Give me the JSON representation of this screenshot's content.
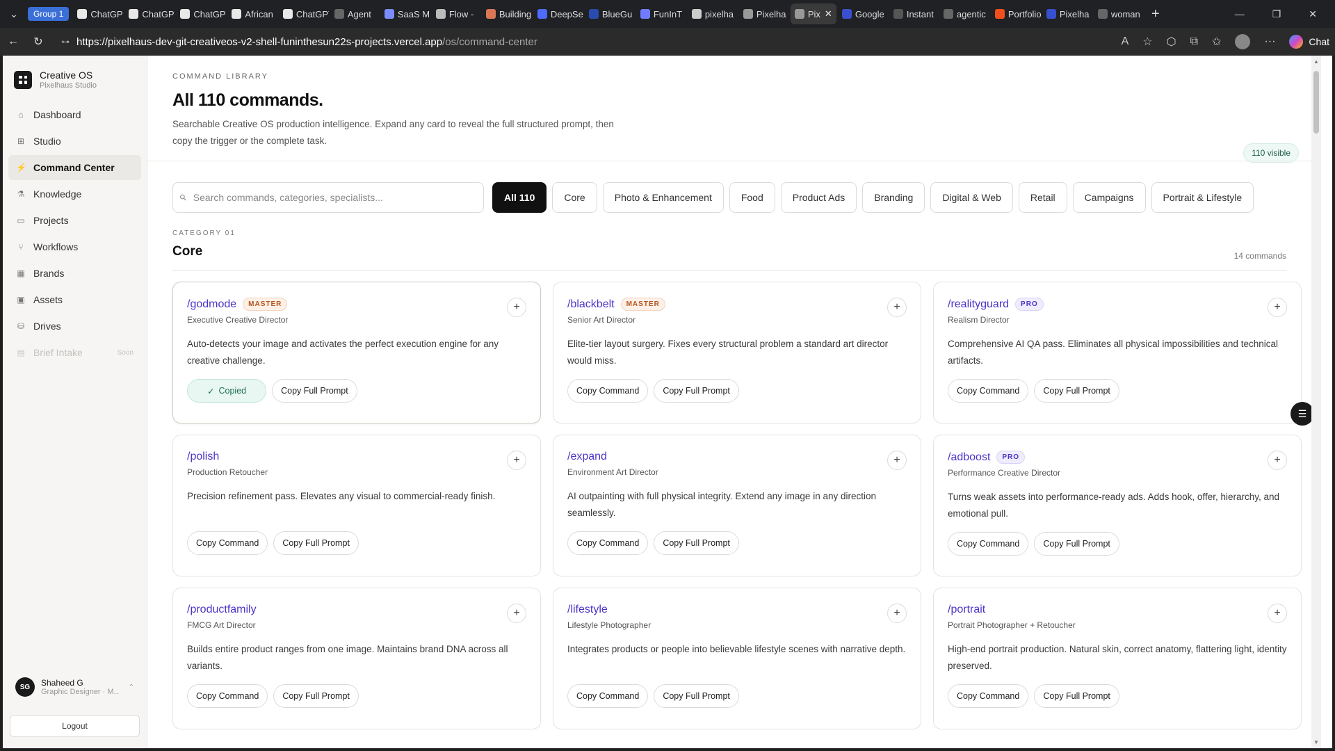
{
  "browser": {
    "group_label": "Group 1",
    "tabs": [
      {
        "title": "ChatGPT",
        "icon": "chatgpt-icon"
      },
      {
        "title": "ChatGPT",
        "icon": "chatgpt-icon"
      },
      {
        "title": "ChatGPT",
        "icon": "chatgpt-icon"
      },
      {
        "title": "African",
        "icon": "chatgpt-icon"
      },
      {
        "title": "ChatGPT",
        "icon": "chatgpt-icon"
      },
      {
        "title": "Agent",
        "icon": "github-icon"
      },
      {
        "title": "SaaS M",
        "icon": "sparkle-icon"
      },
      {
        "title": "Flow -",
        "icon": "flow-icon"
      },
      {
        "title": "Building",
        "icon": "claude-icon"
      },
      {
        "title": "DeepSe",
        "icon": "deepseek-icon"
      },
      {
        "title": "BlueGu",
        "icon": "bluegu-icon"
      },
      {
        "title": "FunInT",
        "icon": "wave-icon"
      },
      {
        "title": "pixelha",
        "icon": "vercel-icon"
      },
      {
        "title": "Pixelha",
        "icon": "globe-icon"
      },
      {
        "title": "Pix",
        "icon": "globe-icon",
        "active": true
      },
      {
        "title": "Google",
        "icon": "form-icon"
      },
      {
        "title": "Instant",
        "icon": "instant-icon"
      },
      {
        "title": "agentic",
        "icon": "github-icon"
      },
      {
        "title": "Portfolio",
        "icon": "figma-icon"
      },
      {
        "title": "Pixelha",
        "icon": "site-icon"
      },
      {
        "title": "woman",
        "icon": "github-icon"
      }
    ],
    "url_host": "https://pixelhaus-dev-git-creativeos-v2-shell-funinthesun22s-projects.vercel.app",
    "url_path": "/os/command-center",
    "chat_label": "Chat"
  },
  "sidebar": {
    "brand_title": "Creative OS",
    "brand_sub": "Pixelhaus Studio",
    "items": [
      {
        "label": "Dashboard",
        "icon": "home-icon"
      },
      {
        "label": "Studio",
        "icon": "studio-icon"
      },
      {
        "label": "Command Center",
        "icon": "bolt-icon",
        "active": true
      },
      {
        "label": "Knowledge",
        "icon": "knowledge-icon"
      },
      {
        "label": "Projects",
        "icon": "folder-icon"
      },
      {
        "label": "Workflows",
        "icon": "workflow-icon"
      },
      {
        "label": "Brands",
        "icon": "grid-icon"
      },
      {
        "label": "Assets",
        "icon": "image-icon"
      },
      {
        "label": "Drives",
        "icon": "drive-icon"
      },
      {
        "label": "Brief Intake",
        "icon": "doc-icon",
        "disabled": true,
        "badge": "Soon"
      }
    ],
    "user": {
      "initials": "SG",
      "name": "Shaheed G",
      "role": "Graphic Designer · M..."
    },
    "logout_label": "Logout"
  },
  "header": {
    "eyebrow": "COMMAND LIBRARY",
    "title": "All 110 commands.",
    "description": "Searchable Creative OS production intelligence. Expand any card to reveal the full structured prompt, then copy the trigger or the complete task.",
    "visible_badge": "110 visible"
  },
  "search": {
    "placeholder": "Search commands, categories, specialists..."
  },
  "filters": [
    "All 110",
    "Core",
    "Photo & Enhancement",
    "Food",
    "Product Ads",
    "Branding",
    "Digital & Web",
    "Retail",
    "Campaigns",
    "Portrait & Lifestyle"
  ],
  "category": {
    "eyebrow": "CATEGORY 01",
    "title": "Core",
    "count": "14 commands"
  },
  "labels": {
    "copy_command": "Copy Command",
    "copy_full_prompt": "Copy Full Prompt",
    "copied": "Copied"
  },
  "cards": [
    {
      "cmd": "/godmode",
      "tier": "MASTER",
      "role": "Executive Creative Director",
      "desc": "Auto-detects your image and activates the perfect execution engine for any creative challenge.",
      "copied": true
    },
    {
      "cmd": "/blackbelt",
      "tier": "MASTER",
      "role": "Senior Art Director",
      "desc": "Elite-tier layout surgery. Fixes every structural problem a standard art director would miss."
    },
    {
      "cmd": "/realityguard",
      "tier": "PRO",
      "role": "Realism Director",
      "desc": "Comprehensive AI QA pass. Eliminates all physical impossibilities and technical artifacts."
    },
    {
      "cmd": "/polish",
      "tier": "",
      "role": "Production Retoucher",
      "desc": "Precision refinement pass. Elevates any visual to commercial-ready finish."
    },
    {
      "cmd": "/expand",
      "tier": "",
      "role": "Environment Art Director",
      "desc": "AI outpainting with full physical integrity. Extend any image in any direction seamlessly."
    },
    {
      "cmd": "/adboost",
      "tier": "PRO",
      "role": "Performance Creative Director",
      "desc": "Turns weak assets into performance-ready ads. Adds hook, offer, hierarchy, and emotional pull."
    },
    {
      "cmd": "/productfamily",
      "tier": "",
      "role": "FMCG Art Director",
      "desc": "Builds entire product ranges from one image. Maintains brand DNA across all variants."
    },
    {
      "cmd": "/lifestyle",
      "tier": "",
      "role": "Lifestyle Photographer",
      "desc": "Integrates products or people into believable lifestyle scenes with narrative depth."
    },
    {
      "cmd": "/portrait",
      "tier": "",
      "role": "Portrait Photographer + Retoucher",
      "desc": "High-end portrait production. Natural skin, correct anatomy, flattering light, identity preserved."
    }
  ]
}
